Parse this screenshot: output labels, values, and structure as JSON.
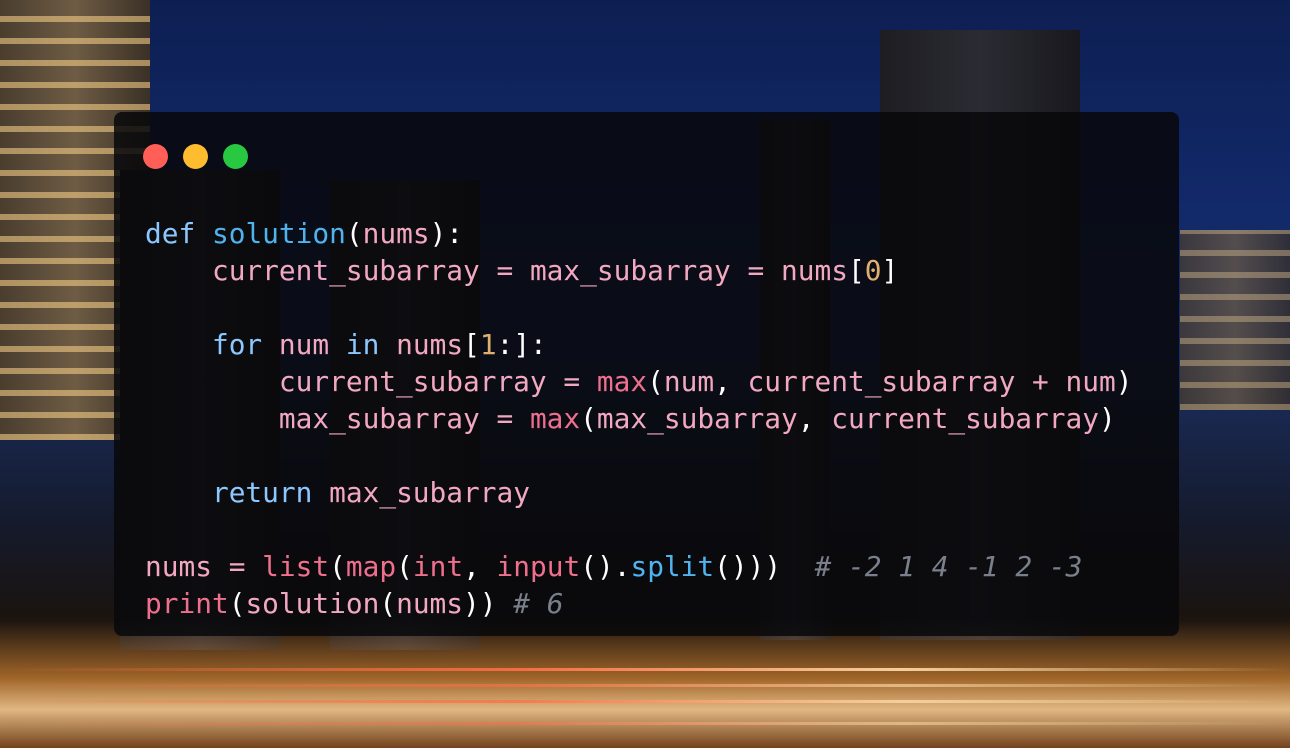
{
  "window_controls": [
    {
      "name": "close",
      "color": "#ff5f57"
    },
    {
      "name": "minimize",
      "color": "#febc2e"
    },
    {
      "name": "zoom",
      "color": "#28c840"
    }
  ],
  "code_lines": [
    [
      {
        "t": "def",
        "c": "kw"
      },
      {
        "t": " ",
        "c": "punc"
      },
      {
        "t": "solution",
        "c": "fn"
      },
      {
        "t": "(",
        "c": "punc"
      },
      {
        "t": "nums",
        "c": "var"
      },
      {
        "t": "):",
        "c": "punc"
      }
    ],
    [
      {
        "t": "    ",
        "c": "punc"
      },
      {
        "t": "current_subarray",
        "c": "var"
      },
      {
        "t": " = ",
        "c": "op"
      },
      {
        "t": "max_subarray",
        "c": "var"
      },
      {
        "t": " = ",
        "c": "op"
      },
      {
        "t": "nums",
        "c": "var"
      },
      {
        "t": "[",
        "c": "punc"
      },
      {
        "t": "0",
        "c": "num"
      },
      {
        "t": "]",
        "c": "punc"
      }
    ],
    [],
    [
      {
        "t": "    ",
        "c": "punc"
      },
      {
        "t": "for",
        "c": "kw"
      },
      {
        "t": " ",
        "c": "punc"
      },
      {
        "t": "num",
        "c": "var"
      },
      {
        "t": " ",
        "c": "punc"
      },
      {
        "t": "in",
        "c": "kw"
      },
      {
        "t": " ",
        "c": "punc"
      },
      {
        "t": "nums",
        "c": "var"
      },
      {
        "t": "[",
        "c": "punc"
      },
      {
        "t": "1",
        "c": "num"
      },
      {
        "t": ":]:",
        "c": "punc"
      }
    ],
    [
      {
        "t": "        ",
        "c": "punc"
      },
      {
        "t": "current_subarray",
        "c": "var"
      },
      {
        "t": " = ",
        "c": "op"
      },
      {
        "t": "max",
        "c": "bi"
      },
      {
        "t": "(",
        "c": "punc"
      },
      {
        "t": "num",
        "c": "var"
      },
      {
        "t": ", ",
        "c": "punc"
      },
      {
        "t": "current_subarray",
        "c": "var"
      },
      {
        "t": " + ",
        "c": "op"
      },
      {
        "t": "num",
        "c": "var"
      },
      {
        "t": ")",
        "c": "punc"
      }
    ],
    [
      {
        "t": "        ",
        "c": "punc"
      },
      {
        "t": "max_subarray",
        "c": "var"
      },
      {
        "t": " = ",
        "c": "op"
      },
      {
        "t": "max",
        "c": "bi"
      },
      {
        "t": "(",
        "c": "punc"
      },
      {
        "t": "max_subarray",
        "c": "var"
      },
      {
        "t": ", ",
        "c": "punc"
      },
      {
        "t": "current_subarray",
        "c": "var"
      },
      {
        "t": ")",
        "c": "punc"
      }
    ],
    [],
    [
      {
        "t": "    ",
        "c": "punc"
      },
      {
        "t": "return",
        "c": "kw"
      },
      {
        "t": " ",
        "c": "punc"
      },
      {
        "t": "max_subarray",
        "c": "var"
      }
    ],
    [],
    [
      {
        "t": "nums",
        "c": "var"
      },
      {
        "t": " = ",
        "c": "op"
      },
      {
        "t": "list",
        "c": "bi"
      },
      {
        "t": "(",
        "c": "punc"
      },
      {
        "t": "map",
        "c": "bi"
      },
      {
        "t": "(",
        "c": "punc"
      },
      {
        "t": "int",
        "c": "bi"
      },
      {
        "t": ", ",
        "c": "punc"
      },
      {
        "t": "input",
        "c": "bi"
      },
      {
        "t": "().",
        "c": "punc"
      },
      {
        "t": "split",
        "c": "fn"
      },
      {
        "t": "()))",
        "c": "punc"
      },
      {
        "t": "  ",
        "c": "punc"
      },
      {
        "t": "# -2 1 4 -1 2 -3",
        "c": "com"
      }
    ],
    [
      {
        "t": "print",
        "c": "bi"
      },
      {
        "t": "(",
        "c": "punc"
      },
      {
        "t": "solution",
        "c": "var"
      },
      {
        "t": "(",
        "c": "punc"
      },
      {
        "t": "nums",
        "c": "var"
      },
      {
        "t": "))",
        "c": "punc"
      },
      {
        "t": " ",
        "c": "punc"
      },
      {
        "t": "# 6",
        "c": "com"
      }
    ]
  ]
}
